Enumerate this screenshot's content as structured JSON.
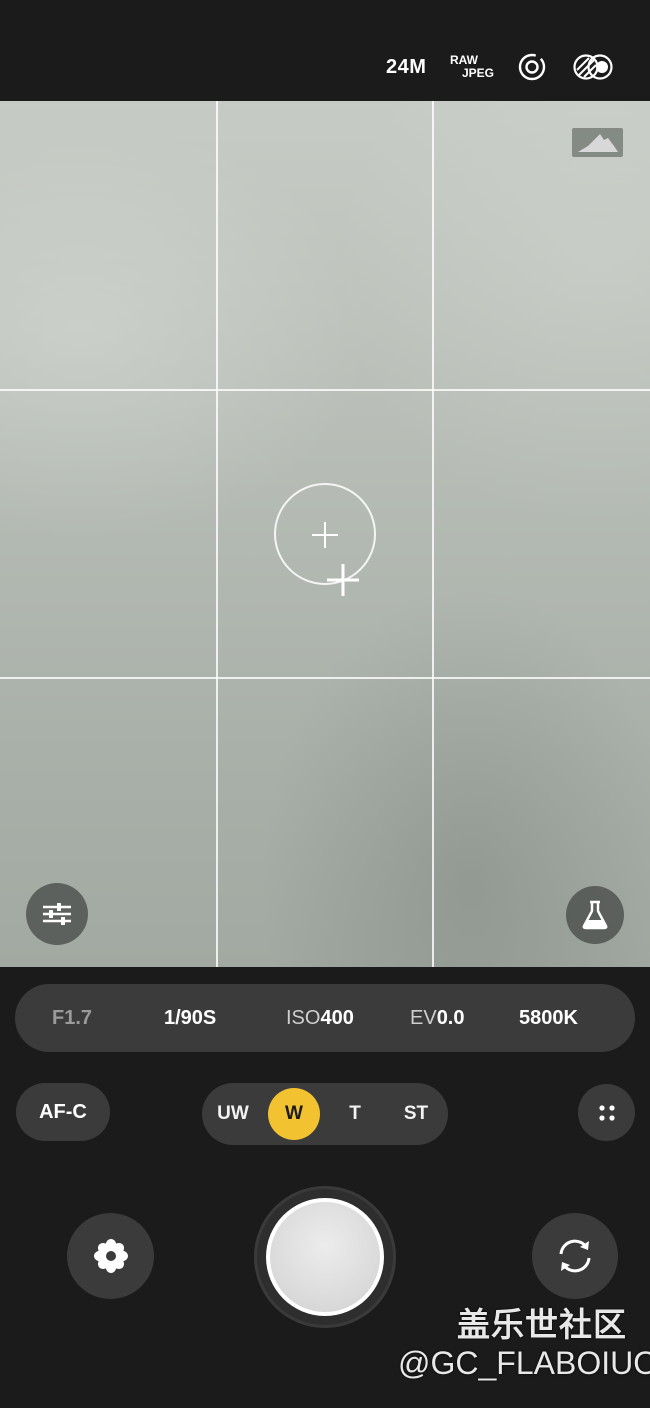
{
  "top_bar": {
    "resolution": "24M",
    "format_line1": "RAW",
    "format_line2": "JPEG",
    "icons": [
      "timer-icon",
      "filter-icon"
    ]
  },
  "viewfinder": {
    "grid": "3x3",
    "overlay_icons": [
      "histogram-icon",
      "focus-ring",
      "metering-point-icon",
      "settings-sliders-icon",
      "lab-flask-icon"
    ]
  },
  "pro_bar": {
    "aperture": "F1.7",
    "shutter": "1/90S",
    "iso_label": "ISO",
    "iso_value": "400",
    "ev_label": "EV",
    "ev_value": "0.0",
    "white_balance": "5800K"
  },
  "controls": {
    "af_mode": "AF-C",
    "lenses": [
      "UW",
      "W",
      "T",
      "ST"
    ],
    "active_lens": "W",
    "accent_color": "#f2c230",
    "icons": [
      "more-icon",
      "mode-flower-icon",
      "switch-camera-icon"
    ]
  },
  "watermark": {
    "title": "盖乐世社区",
    "handle": "@GC_FLABOIUO"
  }
}
